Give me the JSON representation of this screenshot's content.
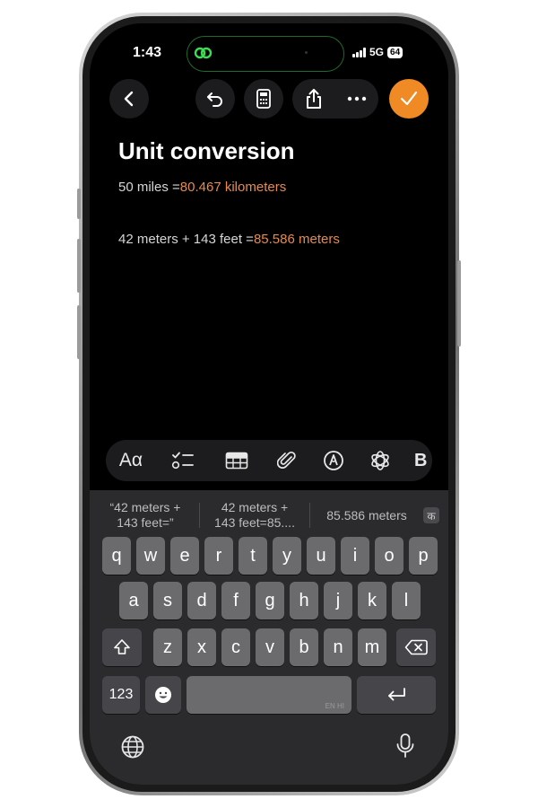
{
  "status": {
    "time": "1:43",
    "network": "5G",
    "battery": "64",
    "island_icon": "link-chain-icon"
  },
  "toolbar": {
    "back_icon": "chevron-left-icon",
    "undo_icon": "undo-icon",
    "calculator_icon": "calculator-icon",
    "share_icon": "share-icon",
    "more_icon": "ellipsis-icon",
    "done_icon": "checkmark-icon",
    "accent": "#f08a24"
  },
  "note": {
    "title": "Unit conversion",
    "lines": [
      {
        "expression": "50 miles =",
        "result": "80.467 kilometers"
      },
      {
        "expression": "42 meters + 143 feet =",
        "result": "85.586 meters"
      }
    ],
    "result_color": "#e88a4a"
  },
  "format_bar": {
    "text_style": "Aα",
    "icons": [
      "checklist-icon",
      "table-icon",
      "paperclip-icon",
      "pen-markup-icon",
      "apple-intelligence-icon"
    ]
  },
  "keyboard": {
    "suggestions": [
      {
        "line1": "“42 meters +",
        "line2": "143 feet=”"
      },
      {
        "line1": "42 meters +",
        "line2": "143 feet=85...."
      },
      {
        "line1": "85.586 meters",
        "line2": ""
      }
    ],
    "suggestion_badge": "क",
    "row1": [
      "q",
      "w",
      "e",
      "r",
      "t",
      "y",
      "u",
      "i",
      "o",
      "p"
    ],
    "row2": [
      "a",
      "s",
      "d",
      "f",
      "g",
      "h",
      "j",
      "k",
      "l"
    ],
    "row3": [
      "z",
      "x",
      "c",
      "v",
      "b",
      "n",
      "m"
    ],
    "numbers_key": "123",
    "space_hint": "EN HI"
  }
}
